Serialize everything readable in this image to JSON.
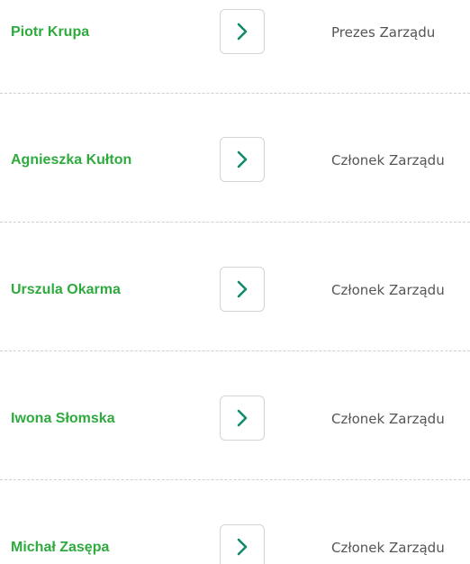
{
  "board": {
    "members": [
      {
        "name": "Piotr Krupa",
        "role": "Prezes Zarządu",
        "arrow_icon": "chevron-right-icon"
      },
      {
        "name": "Agnieszka Kułton",
        "role": "Członek Zarządu",
        "arrow_icon": "chevron-right-icon"
      },
      {
        "name": "Urszula Okarma",
        "role": "Członek Zarządu",
        "arrow_icon": "chevron-right-icon"
      },
      {
        "name": "Iwona Słomska",
        "role": "Członek Zarządu",
        "arrow_icon": "chevron-right-icon"
      },
      {
        "name": "Michał Zasępa",
        "role": "Członek Zarządu",
        "arrow_icon": "chevron-right-icon"
      }
    ]
  },
  "colors": {
    "name_text": "#2faa3f",
    "chevron": "#128a6a",
    "role_text": "#555555",
    "divider": "#cfcfcf",
    "button_border": "#d4d4d4"
  }
}
